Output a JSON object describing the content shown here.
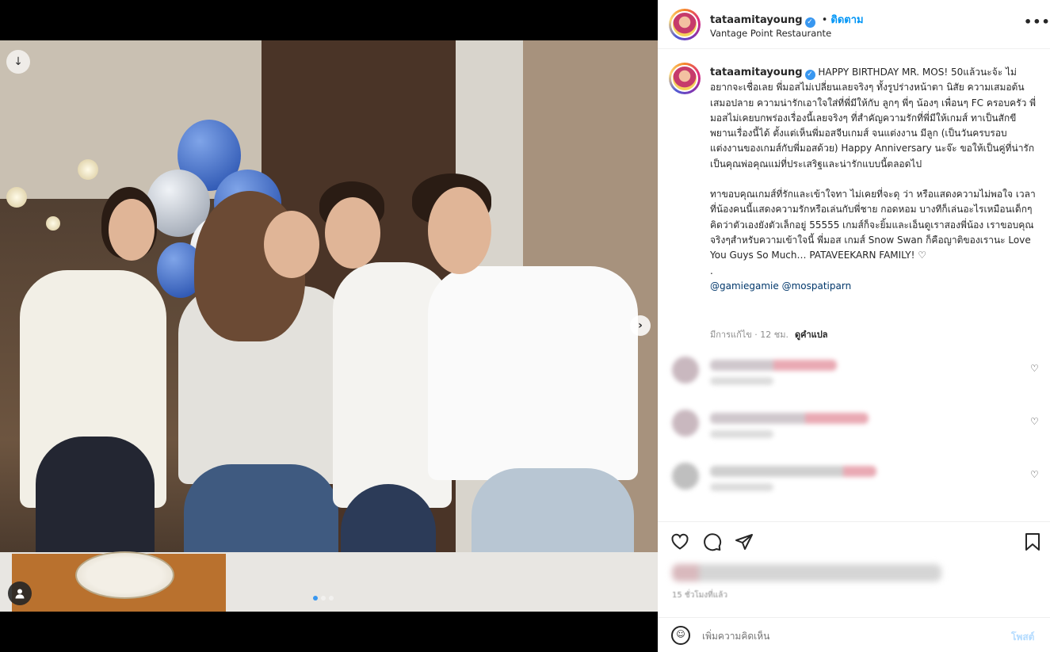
{
  "post": {
    "username": "tataamitayoung",
    "follow_separator": "•",
    "follow_label": "ติดตาม",
    "location": "Vantage Point Restaurante",
    "more_label": "•••"
  },
  "caption": {
    "username": "tataamitayoung",
    "paragraph1": "HAPPY BIRTHDAY MR. MOS! 50แล้วนะจ้ะ ไม่อยากจะเชื่อเลย พี่มอสไม่เปลี่ยนเลยจริงๆ ทั้งรูปร่างหน้าตา นิสัย ความเสมอต้นเสมอปลาย ความน่ารักเอาใจใส่ที่พี่มีให้กับ ลูกๆ พี่ๆ น้องๆ เพื่อนๆ FC ครอบครัว พี่มอสไม่เคยบกพร่องเรื่องนี้เลยจริงๆ ที่สำคัญความรักที่พี่มีให้เกมส์ ทาเป็นสักขีพยานเรื่องนี้ได้ ตั้งแต่เห็นพี่มอสจีบเกมส์ จนแต่งงาน มีลูก (เป็นวันครบรอบแต่งงานของเกมส์กับพี่มอสด้วย) Happy Anniversary นะจ๊ะ ขอให้เป็นคู่ที่น่ารักเป็นคุณพ่อคุณแม่ที่ประเสริฐและน่ารักแบบนี้ตลอดไป",
    "paragraph2": "ทาขอบคุณเกมส์ที่รักและเข้าใจทา ไม่เคยที่จะดุ ว่า หรือแสดงความไม่พอใจ เวลาที่น้องคนนี้แสดงความรักหรือเล่นกับพี่ชาย กอดหอม บางทีก็เล่นอะไรเหมือนเด็กๆ คิดว่าตัวเองยังตัวเล็กอยู่ 55555 เกมส์ก็จะยิ้มและเอ็นดูเราสองพี่น้อง เราขอบคุณจริงๆสำหรับความเข้าใจนี้ พี่มอส เกมส์ Snow Swan ก็คือญาติของเรานะ Love You Guys So Much… PATAVEEKARN FAMILY! ♡",
    "dot_line": ".",
    "mention1": "@gamiegamie",
    "mention2": "@mospatiparn",
    "edited_label": "มีการแก้ไข · 12 ชม.",
    "translate_label": "ดูคำแปล"
  },
  "comments": [
    {
      "heart": "♡"
    },
    {
      "heart": "♡"
    },
    {
      "heart": "♡"
    }
  ],
  "actions": {
    "like_icon": "heart-icon",
    "comment_icon": "comment-icon",
    "share_icon": "send-icon",
    "save_icon": "bookmark-icon"
  },
  "timestamp": "15 ชั่วโมงที่แล้ว",
  "comment_box": {
    "placeholder": "เพิ่มความคิดเห็น",
    "post_label": "โพสต์",
    "emoji_icon": "☺"
  },
  "media": {
    "next_arrow": "›",
    "download_icon": "↓",
    "tag_icon": "●",
    "carousel_count": 3,
    "active_index": 0,
    "colors": {
      "accent": "#0095f6",
      "dot_active": "#3897f0"
    }
  }
}
